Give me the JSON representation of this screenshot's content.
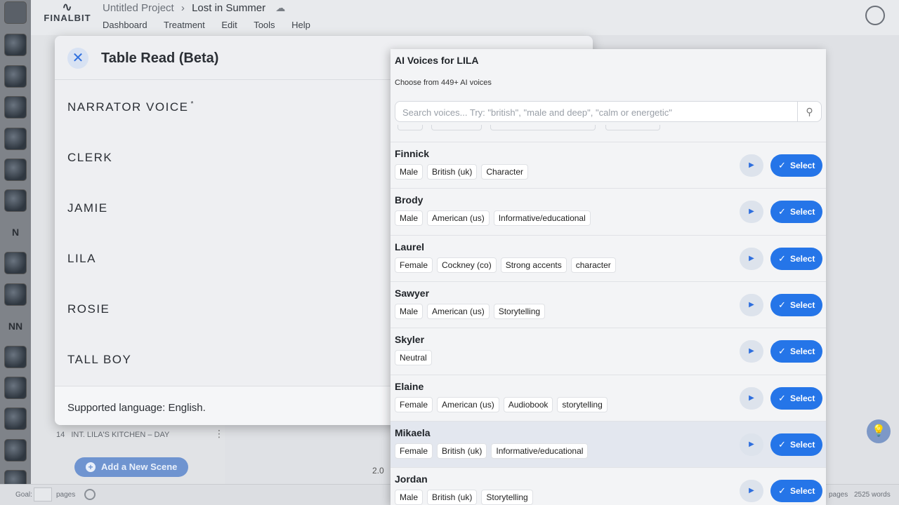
{
  "app": {
    "logo": "FINALBIT",
    "project": "Untitled Project",
    "current_script": "Lost in Summer",
    "menu": [
      "Dashboard",
      "Treatment",
      "Edit",
      "Tools",
      "Help"
    ],
    "rail_letters": [
      "N",
      "NN"
    ],
    "scene_item": {
      "number": "14",
      "title": "INT. LILA'S KITCHEN – DAY"
    },
    "add_scene_label": "Add a New Scene",
    "page_number": "2.0",
    "footer": {
      "goal_label": "Goal:",
      "pages_label": "pages",
      "pages_right": "pages",
      "word_count": "2525 words"
    }
  },
  "table_read": {
    "title": "Table Read (Beta)",
    "characters": [
      {
        "name": "NARRATOR VOICE",
        "marker": "*"
      },
      {
        "name": "CLERK"
      },
      {
        "name": "JAMIE"
      },
      {
        "name": "LILA"
      },
      {
        "name": "ROSIE"
      },
      {
        "name": "TALL BOY"
      }
    ],
    "language_note": "Supported language: English."
  },
  "voices_panel": {
    "title": "AI Voices for LILA",
    "subtitle": "Choose from 449+ AI voices",
    "search_placeholder": "Search voices... Try: \"british\", \"male and deep\", \"calm or energetic\"",
    "select_label": "Select",
    "highlighted_index": 6,
    "voices": [
      {
        "name": "Finnick",
        "tags": [
          "Male",
          "British (uk)",
          "Character"
        ]
      },
      {
        "name": "Brody",
        "tags": [
          "Male",
          "American (us)",
          "Informative/educational"
        ]
      },
      {
        "name": "Laurel",
        "tags": [
          "Female",
          "Cockney (co)",
          "Strong accents",
          "character"
        ]
      },
      {
        "name": "Sawyer",
        "tags": [
          "Male",
          "American (us)",
          "Storytelling"
        ]
      },
      {
        "name": "Skyler",
        "tags": [
          "Neutral"
        ]
      },
      {
        "name": "Elaine",
        "tags": [
          "Female",
          "American (us)",
          "Audiobook",
          "storytelling"
        ]
      },
      {
        "name": "Mikaela",
        "tags": [
          "Female",
          "British (uk)",
          "Informative/educational"
        ]
      },
      {
        "name": "Jordan",
        "tags": [
          "Male",
          "British (uk)",
          "Storytelling"
        ]
      }
    ]
  },
  "colors": {
    "accent": "#2575e8",
    "modal_bg": "#eeeff2",
    "panel_bg": "#f3f4f6"
  }
}
